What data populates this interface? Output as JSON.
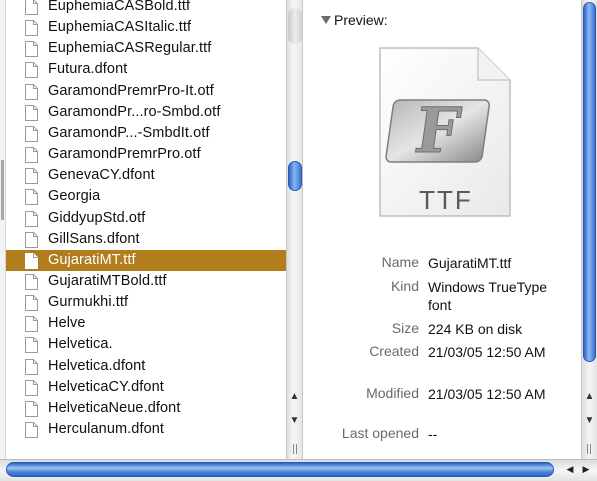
{
  "files": [
    {
      "name": "EuphemiaCASBold.ttf",
      "selected": false
    },
    {
      "name": "EuphemiaCASItalic.ttf",
      "selected": false
    },
    {
      "name": "EuphemiaCASRegular.ttf",
      "selected": false
    },
    {
      "name": "Futura.dfont",
      "selected": false
    },
    {
      "name": "GaramondPremrPro-It.otf",
      "selected": false
    },
    {
      "name": "GaramondPr...ro-Smbd.otf",
      "selected": false
    },
    {
      "name": "GaramondP...-SmbdIt.otf",
      "selected": false
    },
    {
      "name": "GaramondPremrPro.otf",
      "selected": false
    },
    {
      "name": "GenevaCY.dfont",
      "selected": false
    },
    {
      "name": "Georgia",
      "selected": false
    },
    {
      "name": "GiddyupStd.otf",
      "selected": false
    },
    {
      "name": "GillSans.dfont",
      "selected": false
    },
    {
      "name": "GujaratiMT.ttf",
      "selected": true
    },
    {
      "name": "GujaratiMTBold.ttf",
      "selected": false
    },
    {
      "name": "Gurmukhi.ttf",
      "selected": false
    },
    {
      "name": "Helve",
      "selected": false
    },
    {
      "name": "Helvetica.",
      "selected": false
    },
    {
      "name": "Helvetica.dfont",
      "selected": false
    },
    {
      "name": "HelveticaCY.dfont",
      "selected": false
    },
    {
      "name": "HelveticaNeue.dfont",
      "selected": false
    },
    {
      "name": "Herculanum.dfont",
      "selected": false
    }
  ],
  "preview": {
    "heading": "Preview:",
    "icon_text": "TTF",
    "icon_letter": "F",
    "icon": "font-file-icon"
  },
  "info": {
    "name_label": "Name",
    "name_value": "GujaratiMT.ttf",
    "kind_label": "Kind",
    "kind_value": "Windows TrueType font",
    "size_label": "Size",
    "size_value": "224 KB on disk",
    "created_label": "Created",
    "created_value": "21/03/05 12:50 AM",
    "modified_label": "Modified",
    "modified_value": "21/03/05 12:50 AM",
    "last_opened_label": "Last opened",
    "last_opened_value": "--"
  },
  "colors": {
    "selection": "#b17d1d",
    "scroll_thumb": "#3d74d3"
  }
}
